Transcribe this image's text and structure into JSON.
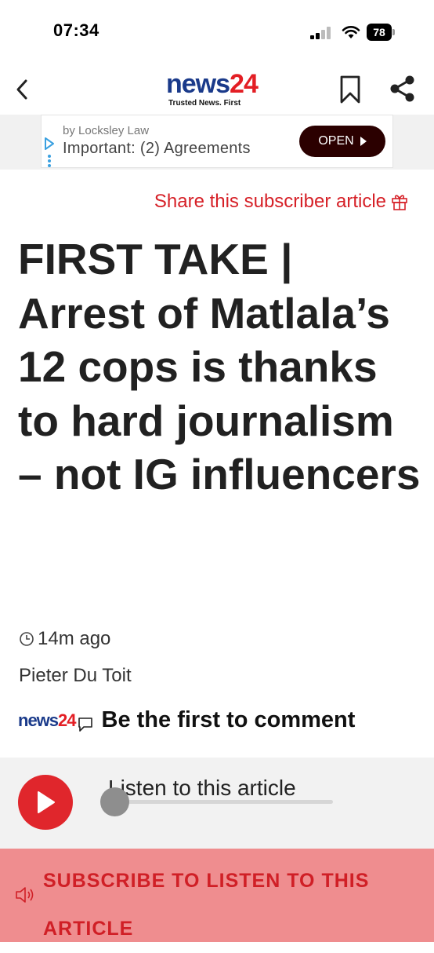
{
  "status_bar": {
    "time": "07:34",
    "battery": "78"
  },
  "header": {
    "logo_name": "news",
    "logo_number": "24",
    "logo_tagline": "Trusted News. First",
    "icons": [
      "back-arrow-icon",
      "bookmark-icon",
      "share-icon"
    ]
  },
  "ad": {
    "sponsor": "by Locksley Law",
    "headline": "Important: (2) Agreements",
    "cta": "OPEN"
  },
  "article": {
    "share_label": "Share this subscriber article",
    "headline": "FIRST TAKE | Arrest of Matlala’s 12 cops is thanks to hard journalism – not IG influencers",
    "published": "14m ago",
    "author": "Pieter Du Toit",
    "comment_logo_name": "news",
    "comment_logo_number": "24",
    "comment_prompt": "Be the first to comment"
  },
  "audio": {
    "label": "Listen to this article",
    "progress": 0,
    "subscribe_cta": "SUBSCRIBE TO LISTEN TO THIS ARTICLE"
  },
  "colors": {
    "brand_blue": "#1a3a8a",
    "brand_red": "#e31e24",
    "accent_red": "#d62027",
    "subscribe_bg": "#ef8d8f"
  }
}
